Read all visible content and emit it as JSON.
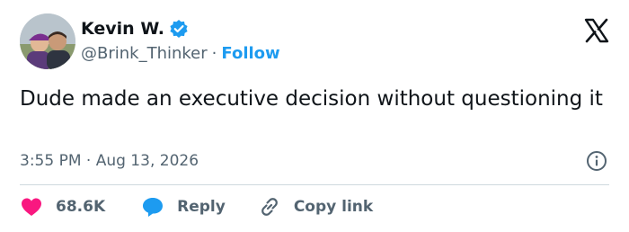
{
  "author": {
    "display_name": "Kevin W.",
    "handle": "@Brink_Thinker",
    "separator": "·",
    "follow_label": "Follow",
    "verified": true
  },
  "tweet": {
    "text": "Dude made an executive decision without questioning it",
    "timestamp": "3:55 PM · Aug 13, 2026"
  },
  "actions": {
    "likes_count": "68.6K",
    "reply_label": "Reply",
    "copy_link_label": "Copy link"
  },
  "icons": {
    "verified": "verified-badge-icon",
    "logo": "x-logo-icon",
    "info": "info-icon",
    "like": "heart-icon",
    "reply": "reply-bubble-icon",
    "copy_link": "link-icon"
  },
  "colors": {
    "accent": "#1d9bf0",
    "heart": "#f91880",
    "text": "#0f1419",
    "secondary": "#536471"
  }
}
